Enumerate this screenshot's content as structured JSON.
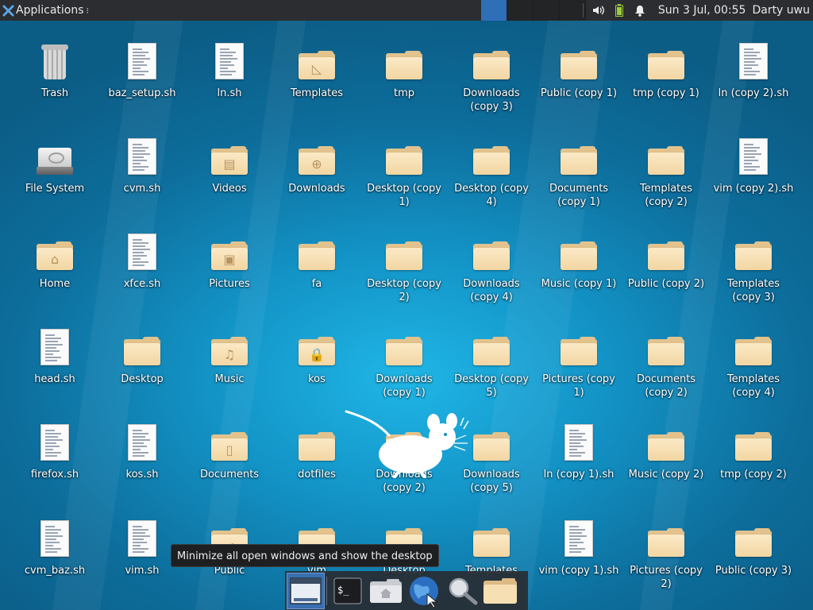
{
  "top_panel": {
    "applications_label": "Applications",
    "clock": "Sun  3 Jul, 00:55",
    "user": "Darty uwu",
    "workspaces": 4,
    "active_workspace": 1
  },
  "desktop_icons": [
    {
      "label": "Trash",
      "type": "trash"
    },
    {
      "label": "baz_setup.sh",
      "type": "script"
    },
    {
      "label": "ln.sh",
      "type": "script"
    },
    {
      "label": "Templates",
      "type": "folder",
      "emblem": "templates"
    },
    {
      "label": "tmp",
      "type": "folder"
    },
    {
      "label": "Downloads (copy 3)",
      "type": "folder"
    },
    {
      "label": "Public (copy 1)",
      "type": "folder"
    },
    {
      "label": "tmp (copy 1)",
      "type": "folder"
    },
    {
      "label": "ln (copy 2).sh",
      "type": "script"
    },
    {
      "label": "File System",
      "type": "drive"
    },
    {
      "label": "cvm.sh",
      "type": "script"
    },
    {
      "label": "Videos",
      "type": "folder",
      "emblem": "film"
    },
    {
      "label": "Downloads",
      "type": "folder",
      "emblem": "download"
    },
    {
      "label": "Desktop (copy 1)",
      "type": "folder"
    },
    {
      "label": "Desktop (copy 4)",
      "type": "folder"
    },
    {
      "label": "Documents (copy 1)",
      "type": "folder"
    },
    {
      "label": "Templates (copy 2)",
      "type": "folder"
    },
    {
      "label": "vim (copy 2).sh",
      "type": "script"
    },
    {
      "label": "Home",
      "type": "folder",
      "emblem": "home"
    },
    {
      "label": "xfce.sh",
      "type": "script"
    },
    {
      "label": "Pictures",
      "type": "folder",
      "emblem": "picture"
    },
    {
      "label": "fa",
      "type": "folder"
    },
    {
      "label": "Desktop (copy 2)",
      "type": "folder"
    },
    {
      "label": "Downloads (copy 4)",
      "type": "folder"
    },
    {
      "label": "Music (copy 1)",
      "type": "folder"
    },
    {
      "label": "Public (copy 2)",
      "type": "folder"
    },
    {
      "label": "Templates (copy 3)",
      "type": "folder"
    },
    {
      "label": "head.sh",
      "type": "script"
    },
    {
      "label": "Desktop",
      "type": "folder"
    },
    {
      "label": "Music",
      "type": "folder",
      "emblem": "music"
    },
    {
      "label": "kos",
      "type": "folder",
      "emblem": "lock"
    },
    {
      "label": "Downloads (copy 1)",
      "type": "folder"
    },
    {
      "label": "Desktop (copy 5)",
      "type": "folder"
    },
    {
      "label": "Pictures (copy 1)",
      "type": "folder"
    },
    {
      "label": "Documents (copy 2)",
      "type": "folder"
    },
    {
      "label": "Templates (copy 4)",
      "type": "folder"
    },
    {
      "label": "firefox.sh",
      "type": "script"
    },
    {
      "label": "kos.sh",
      "type": "script"
    },
    {
      "label": "Documents",
      "type": "folder",
      "emblem": "document"
    },
    {
      "label": "dotfiles",
      "type": "folder"
    },
    {
      "label": "Downloads (copy 2)",
      "type": "folder"
    },
    {
      "label": "Downloads (copy 5)",
      "type": "folder"
    },
    {
      "label": "ln (copy 1).sh",
      "type": "script"
    },
    {
      "label": "Music (copy 2)",
      "type": "folder"
    },
    {
      "label": "tmp (copy 2)",
      "type": "folder"
    },
    {
      "label": "cvm_baz.sh",
      "type": "script"
    },
    {
      "label": "vim.sh",
      "type": "script"
    },
    {
      "label": "Public",
      "type": "folder",
      "emblem": "share"
    },
    {
      "label": "vim",
      "type": "folder"
    },
    {
      "label": "Desktop",
      "type": "folder"
    },
    {
      "label": "Templates",
      "type": "folder"
    },
    {
      "label": "vim (copy 1).sh",
      "type": "script"
    },
    {
      "label": "Pictures (copy 2)",
      "type": "folder"
    },
    {
      "label": "Public (copy 3)",
      "type": "folder"
    }
  ],
  "tooltip": "Minimize all open windows and show the desktop",
  "dock": {
    "items": [
      {
        "name": "show-desktop",
        "icon": "show-desktop-icon",
        "active": true
      },
      {
        "name": "terminal",
        "icon": "terminal-icon",
        "glyph": "$_"
      },
      {
        "name": "file-manager",
        "icon": "home-folder-icon"
      },
      {
        "name": "web-browser",
        "icon": "globe-icon"
      },
      {
        "name": "app-finder",
        "icon": "magnifier-icon"
      },
      {
        "name": "folder",
        "icon": "folder-icon"
      }
    ]
  }
}
